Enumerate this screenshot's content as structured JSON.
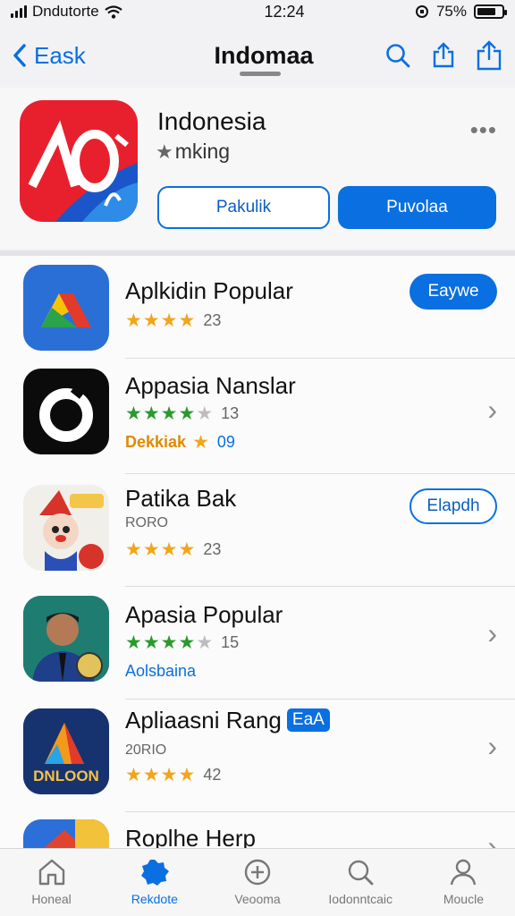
{
  "status": {
    "carrier": "Dndutorte",
    "time": "12:24",
    "battery": "75%",
    "battery_level": 0.75
  },
  "nav": {
    "back_label": "Eask",
    "title": "Indomaa"
  },
  "hero": {
    "title": "Indonesia",
    "subtitle": "mking",
    "more": "•••",
    "secondary_button": "Pakulik",
    "primary_button": "Puvolaa"
  },
  "rows": [
    {
      "title": "Aplkidin Popular",
      "rating": 4,
      "count": "23",
      "action": "Eaywe"
    },
    {
      "title": "Appasia Nanslar",
      "rating": 4,
      "count": "13",
      "line2_label": "Dekkiak",
      "line2_count": "09"
    },
    {
      "title": "Patika Bak",
      "subtitle": "RORO",
      "rating": 4,
      "count": "23",
      "action": "Elapdh"
    },
    {
      "title": "Apasia Popular",
      "rating": 4,
      "count": "15",
      "line2_label": "Aolsbaina"
    },
    {
      "title": "Apliaasni Rang",
      "badge": "EaA",
      "subtitle": "20RIO",
      "rating": 4,
      "count": "42",
      "icon_text": "DNLOON"
    },
    {
      "title": "Roplhe Herp"
    }
  ],
  "tabs": [
    {
      "label": "Honeal",
      "icon": "home-icon"
    },
    {
      "label": "Rekdote",
      "icon": "today-icon"
    },
    {
      "label": "Veooma",
      "icon": "plus-circle-icon"
    },
    {
      "label": "Iodonntcaic",
      "icon": "search-icon"
    },
    {
      "label": "Moucle",
      "icon": "person-icon"
    }
  ],
  "colors": {
    "accent": "#0a6fe0",
    "star_gold": "#f3a51a",
    "star_green": "#2a9a2a"
  }
}
